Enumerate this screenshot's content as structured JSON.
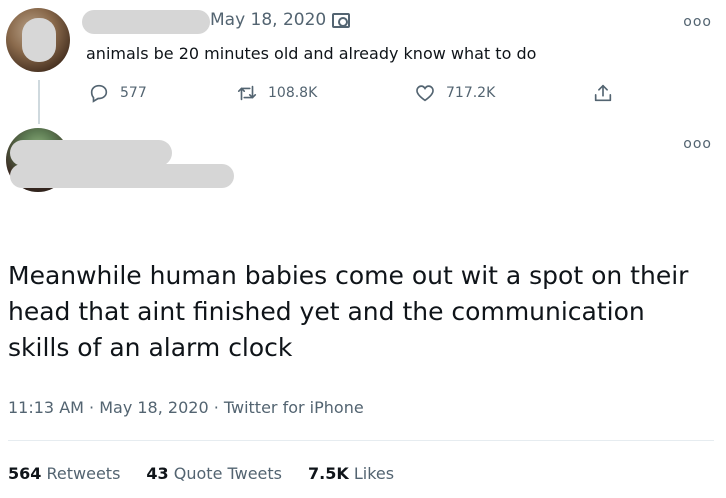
{
  "reply_tweet": {
    "date": "May 18, 2020",
    "text": "animals be 20 minutes old and already know what to do",
    "actions": {
      "replies": "577",
      "retweets": "108.8K",
      "likes": "717.2K"
    }
  },
  "main_tweet": {
    "text": "Meanwhile human babies come out wit a spot on their head that aint finished yet and the communication skills of an alarm clock",
    "timestamp": "11:13 AM · May 18, 2020 · Twitter for iPhone",
    "stats": {
      "retweets_count": "564",
      "retweets_label": "Retweets",
      "quotes_count": "43",
      "quotes_label": "Quote Tweets",
      "likes_count": "7.5K",
      "likes_label": "Likes"
    }
  },
  "more_label": "ooo",
  "icons": [
    "camera-icon",
    "reply-icon",
    "retweet-icon",
    "like-icon",
    "share-icon",
    "more-icon"
  ],
  "colors": {
    "secondary_text": "#536471",
    "primary_text": "#0f1419",
    "divider": "#e6ecf0"
  }
}
